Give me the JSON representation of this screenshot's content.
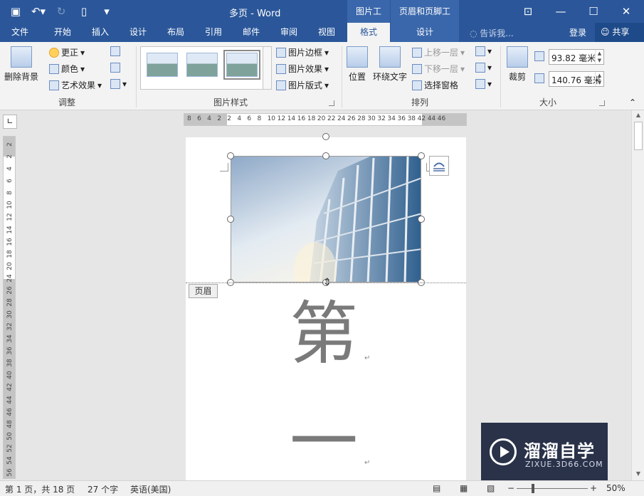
{
  "titlebar": {
    "title": "多页 - Word",
    "ctx_picture_tools": "图片工具",
    "ctx_header_footer_tools": "页眉和页脚工具"
  },
  "tabs": [
    "文件",
    "开始",
    "插入",
    "设计",
    "布局",
    "引用",
    "邮件",
    "审阅",
    "视图",
    "格式",
    "设计"
  ],
  "active_tab": "格式",
  "tellme": "告诉我...",
  "login": "登录",
  "share": "共享",
  "ribbon": {
    "adjust": {
      "remove_bg": "删除背景",
      "corrections": "更正",
      "color": "颜色",
      "artistic": "艺术效果",
      "group": "调整"
    },
    "styles": {
      "border": "图片边框",
      "effects": "图片效果",
      "layout": "图片版式",
      "group": "图片样式"
    },
    "arrange": {
      "position": "位置",
      "wrap": "环绕文字",
      "bring_forward": "上移一层",
      "send_backward": "下移一层",
      "selection_pane": "选择窗格",
      "group": "排列"
    },
    "size": {
      "crop": "裁剪",
      "height": "93.82 毫米",
      "width": "140.76 毫米",
      "group": "大小"
    }
  },
  "ruler": {
    "h_labels": [
      "8",
      "6",
      "4",
      "2",
      "2",
      "4",
      "6",
      "8",
      "10",
      "12",
      "14",
      "16",
      "18",
      "20",
      "22",
      "24",
      "26",
      "28",
      "30",
      "32",
      "34",
      "36",
      "38",
      "42",
      "44",
      "46"
    ],
    "v_labels": [
      "2",
      "2",
      "4",
      "6",
      "8",
      "10",
      "12",
      "14",
      "16",
      "18",
      "20",
      "24",
      "26",
      "28",
      "30",
      "32",
      "34",
      "36",
      "38",
      "40",
      "42",
      "44",
      "46",
      "48",
      "50",
      "52",
      "54",
      "56"
    ]
  },
  "page": {
    "header_tag": "页眉",
    "char1": "第",
    "char2": "一",
    "para_mark": "↵"
  },
  "status": {
    "page": "第 1 页，共 18 页",
    "words": "27 个字",
    "lang": "英语(美国)",
    "zoom": "50%"
  },
  "watermark": {
    "title": "溜溜自学",
    "sub": "ZIXUE.3D66.COM"
  }
}
